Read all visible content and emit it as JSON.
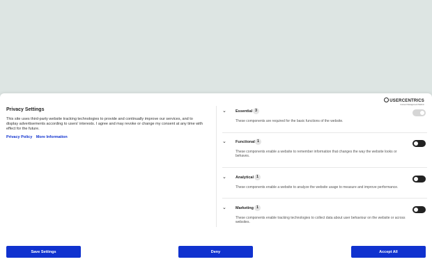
{
  "banner": {
    "title": "Privacy Settings",
    "description": "This site uses third-party website tracking technologies to provide and continually improve our services, and to display advertisements according to users' interests. I agree and may revoke or change my consent at any time with effect for the future.",
    "privacy_policy_link": "Privacy Policy",
    "more_info_link": "More Information"
  },
  "brand": {
    "name": "USERCENTRICS",
    "tagline": "Consent Management Platform"
  },
  "categories": [
    {
      "title": "Essential",
      "count": "3",
      "description": "These components are required for the basic functions of the website.",
      "toggle": "on-disabled"
    },
    {
      "title": "Functional",
      "count": "1",
      "description": "These components enable a website to remember information that changes the way the website looks or behaves.",
      "toggle": "off"
    },
    {
      "title": "Analytical",
      "count": "1",
      "description": "These components enable a website to analyze the website usage to measure and improve performance.",
      "toggle": "off"
    },
    {
      "title": "Marketing",
      "count": "1",
      "description": "These components enable tracking technologies to collect data about user behaviour on the website or across websites.",
      "toggle": "off"
    }
  ],
  "buttons": {
    "save": "Save Settings",
    "deny": "Deny",
    "accept": "Accept All"
  },
  "colors": {
    "accent": "#1032cf",
    "background": "#dde5e3"
  }
}
